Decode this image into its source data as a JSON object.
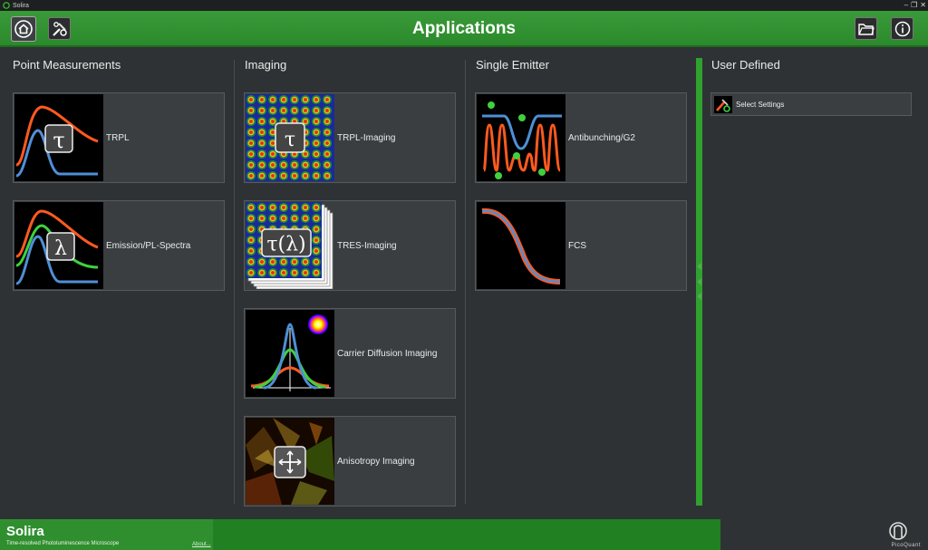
{
  "window": {
    "title": "Solira",
    "controls": [
      "–",
      "❐",
      "✕"
    ]
  },
  "header": {
    "title": "Applications"
  },
  "columns": {
    "point": {
      "title": "Point Measurements",
      "items": [
        {
          "label": "TRPL",
          "symbol": "τ"
        },
        {
          "label": "Emission/PL-Spectra",
          "symbol": "λ"
        }
      ]
    },
    "imaging": {
      "title": "Imaging",
      "items": [
        {
          "label": "TRPL-Imaging",
          "symbol": "τ"
        },
        {
          "label": "TRES-Imaging",
          "symbol": "τ(λ)"
        },
        {
          "label": "Carrier Diffusion Imaging"
        },
        {
          "label": "Anisotropy Imaging"
        }
      ]
    },
    "single": {
      "title": "Single Emitter",
      "items": [
        {
          "label": "Antibunching/G2"
        },
        {
          "label": "FCS"
        }
      ]
    },
    "user": {
      "title": "User Defined",
      "items": [
        {
          "label": "Select Settings"
        }
      ]
    }
  },
  "footer": {
    "app_name": "Solira",
    "subtitle": "Time-resolved Photoluminescence Microscope",
    "about": "About...",
    "company": "PicoQuant"
  },
  "colors": {
    "accent": "#2fa12f",
    "orange": "#ff5a1f",
    "blue": "#4f8fd6",
    "green": "#3fd13f"
  }
}
